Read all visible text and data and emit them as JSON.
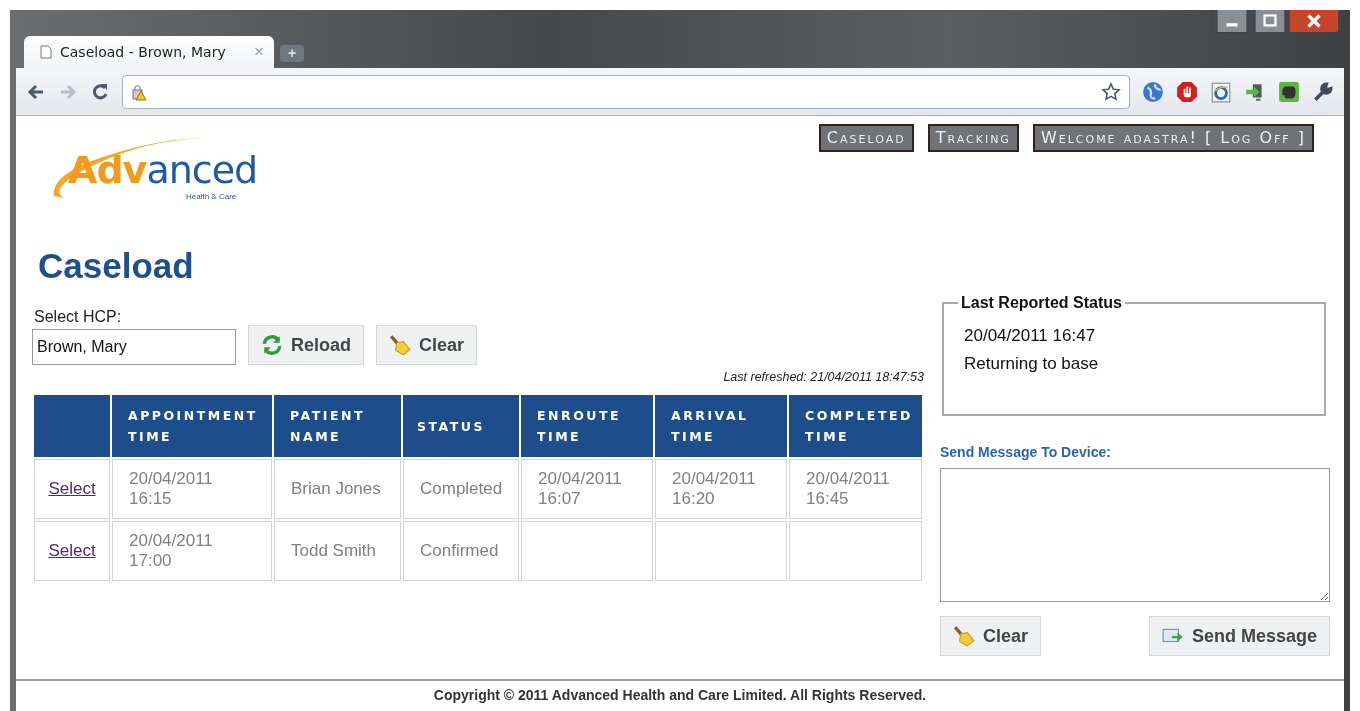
{
  "browser": {
    "tab_title": "Caseload - Brown, Mary",
    "tab_close": "×",
    "new_tab": "+"
  },
  "nav": [
    {
      "label": "Caseload"
    },
    {
      "label": "Tracking"
    },
    {
      "label": "Welcome adastra! [ Log Off ]"
    }
  ],
  "logo": {
    "parts": [
      "Adv",
      "anced"
    ],
    "tagline": "Health & Care"
  },
  "heading": "Caseload",
  "hcp": {
    "label": "Select HCP:",
    "value": "Brown, Mary"
  },
  "buttons": [
    {
      "label": "Reload",
      "kind": "reload"
    },
    {
      "label": "Clear",
      "kind": "clear"
    }
  ],
  "last_refreshed": "Last refreshed: 21/04/2011 18:47:53",
  "table": {
    "columns": [
      "",
      "APPOINTMENT TIME",
      "PATIENT NAME",
      "STATUS",
      "ENROUTE TIME",
      "ARRIVAL TIME",
      "COMPLETED TIME"
    ],
    "rows": [
      {
        "cells": [
          "Select",
          "20/04/2011 16:15",
          "Brian Jones",
          "Completed",
          "20/04/2011 16:07",
          "20/04/2011 16:20",
          "20/04/2011 16:45"
        ]
      },
      {
        "cells": [
          "Select",
          "20/04/2011 17:00",
          "Todd Smith",
          "Confirmed",
          "",
          "",
          ""
        ]
      }
    ]
  },
  "last_status": {
    "title": "Last Reported Status",
    "time": "20/04/2011 16:47",
    "text": "Returning to base"
  },
  "message": {
    "label": "Send Message To Device:",
    "buttons": [
      {
        "label": "Clear",
        "kind": "clear"
      },
      {
        "label": "Send Message",
        "kind": "send"
      }
    ]
  },
  "footer": "Copyright © 2011 Advanced Health and Care Limited. All Rights Reserved."
}
